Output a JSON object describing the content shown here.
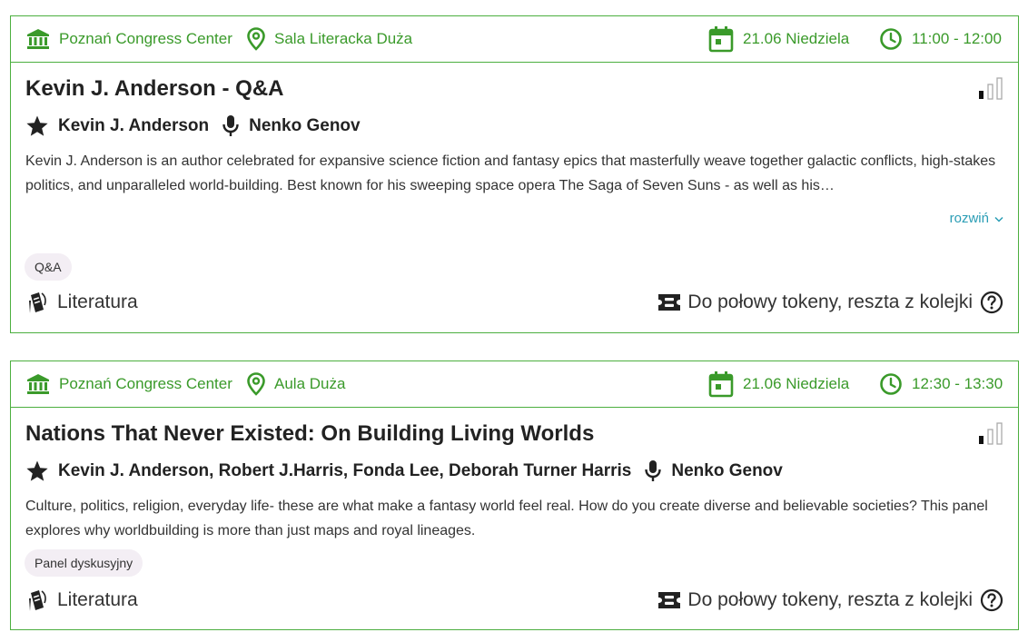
{
  "colors": {
    "accent_green": "#3a9a2a",
    "border_green": "#4caf3f",
    "link_teal": "#2a9db5",
    "tag_bg": "#f3eef4"
  },
  "events": [
    {
      "venue": "Poznań Congress Center",
      "room": "Sala Literacka Duża",
      "date": "21.06 Niedziela",
      "time": "11:00 - 12:00",
      "title": "Kevin J. Anderson - Q&A",
      "guests": "Kevin J. Anderson",
      "moderator": "Nenko Genov",
      "description": "Kevin J. Anderson is an author celebrated for expansive science fiction and fantasy epics that masterfully weave together galactic conflicts, high-stakes politics, and unparalleled world-building. Best known for his sweeping space opera The Saga of Seven Suns - as well as his…",
      "expand_label": "rozwiń",
      "tag": "Q&A",
      "category": "Literatura",
      "entry": "Do połowy tokeny, reszta z kolejki",
      "signal_level": 1,
      "signal_max": 3
    },
    {
      "venue": "Poznań Congress Center",
      "room": "Aula Duża",
      "date": "21.06 Niedziela",
      "time": "12:30 - 13:30",
      "title": "Nations That Never Existed: On Building Living Worlds",
      "guests": "Kevin J. Anderson, Robert J.Harris, Fonda Lee, Deborah Turner Harris",
      "moderator": "Nenko Genov",
      "description": "Culture, politics, religion, everyday life- these are what make a fantasy world feel real. How do you create diverse and believable societies? This panel explores why worldbuilding is more than just maps and royal lineages.",
      "tag": "Panel dyskusyjny",
      "category": "Literatura",
      "entry": "Do połowy tokeny, reszta z kolejki",
      "signal_level": 1,
      "signal_max": 3
    }
  ]
}
